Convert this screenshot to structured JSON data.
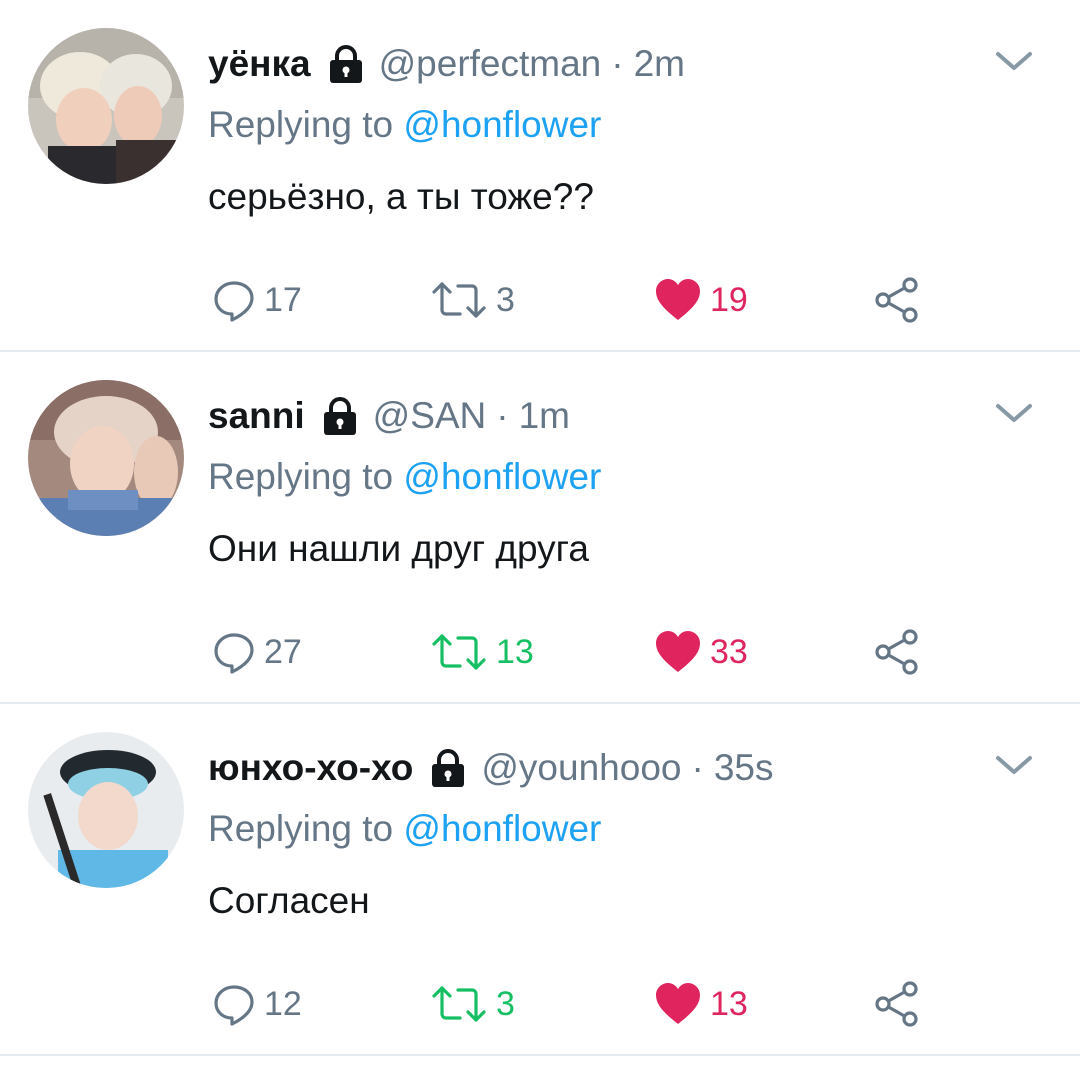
{
  "colors": {
    "text": "#14171a",
    "muted": "#657786",
    "link": "#1da1f2",
    "like": "#e0245e",
    "retweet_active": "#17bf63",
    "divider": "#e6ecf0"
  },
  "icons": {
    "lock": "lock-icon",
    "chevron": "chevron-down-icon",
    "reply": "reply-bubble-icon",
    "retweet": "retweet-icon",
    "like": "heart-icon",
    "share": "share-icon"
  },
  "tweets": [
    {
      "name": "уёнка",
      "handle": "@perfectman",
      "separator": "·",
      "time": "2m",
      "replying_prefix": "Replying to",
      "replying_to": "@honflower",
      "text": "серьёзно, а ты тоже??",
      "replies": "17",
      "retweets": "3",
      "likes": "19",
      "retweeted": false,
      "liked": true
    },
    {
      "name": "sanni",
      "handle": "@SAN",
      "separator": "·",
      "time": "1m",
      "replying_prefix": "Replying to",
      "replying_to": "@honflower",
      "text": "Они нашли друг друга",
      "replies": "27",
      "retweets": "13",
      "likes": "33",
      "retweeted": true,
      "liked": true
    },
    {
      "name": "юнхо-хо-хо",
      "handle": "@younhooo",
      "separator": "·",
      "time": "35s",
      "replying_prefix": "Replying to",
      "replying_to": "@honflower",
      "text": "Согласен",
      "replies": "12",
      "retweets": "3",
      "likes": "13",
      "retweeted": true,
      "liked": true
    }
  ]
}
